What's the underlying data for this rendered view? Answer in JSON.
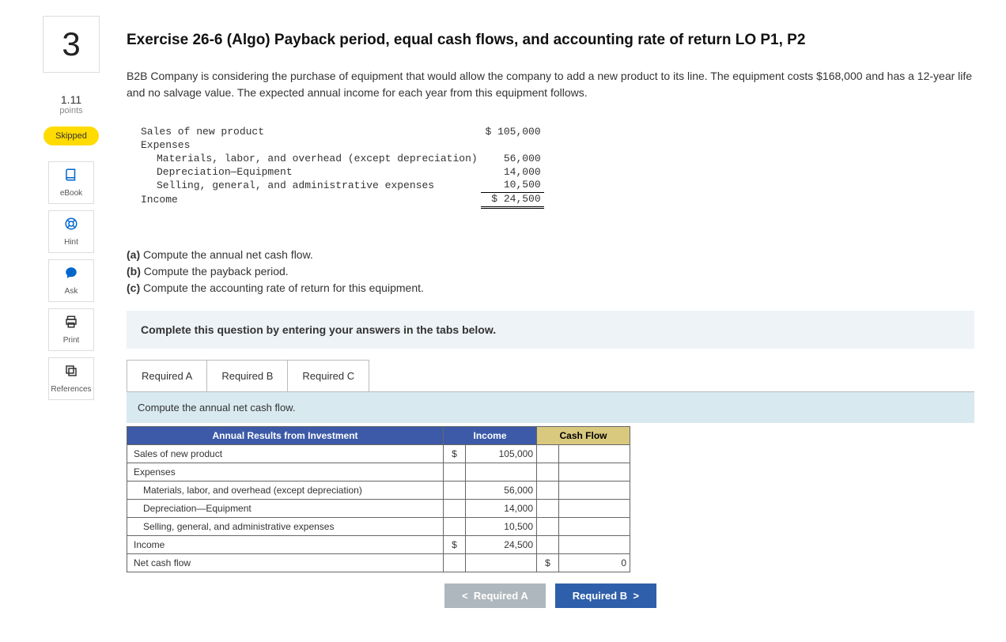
{
  "question_number": "3",
  "points_value": "1.11",
  "points_label": "points",
  "skipped_label": "Skipped",
  "tools": {
    "ebook": "eBook",
    "hint": "Hint",
    "ask": "Ask",
    "print": "Print",
    "references": "References"
  },
  "title": "Exercise 26-6 (Algo) Payback period, equal cash flows, and accounting rate of return LO P1, P2",
  "prompt": "B2B Company is considering the purchase of equipment that would allow the company to add a new product to its line. The equipment costs $168,000 and has a 12-year life and no salvage value. The expected annual income for each year from this equipment follows.",
  "income": {
    "sales_label": "Sales of new product",
    "sales_amt": "$ 105,000",
    "expenses_label": "Expenses",
    "mlo_label": "Materials, labor, and overhead (except depreciation)",
    "mlo_amt": "56,000",
    "dep_label": "Depreciation—Equipment",
    "dep_amt": "14,000",
    "sga_label": "Selling, general, and administrative expenses",
    "sga_amt": "10,500",
    "income_label": "Income",
    "income_amt": "$ 24,500"
  },
  "parts": {
    "a": "(a)",
    "a_text": " Compute the annual net cash flow.",
    "b": "(b)",
    "b_text": " Compute the payback period.",
    "c": "(c)",
    "c_text": " Compute the accounting rate of return for this equipment."
  },
  "instruction": "Complete this question by entering your answers in the tabs below.",
  "tabs": {
    "a": "Required A",
    "b": "Required B",
    "c": "Required C"
  },
  "tab_a_desc": "Compute the annual net cash flow.",
  "table": {
    "h1": "Annual Results from Investment",
    "h2": "Income",
    "h3": "Cash Flow",
    "r1": "Sales of new product",
    "r1_cur": "$",
    "r1_val": "105,000",
    "r2": "Expenses",
    "r3": "Materials, labor, and overhead (except depreciation)",
    "r3_val": "56,000",
    "r4": "Depreciation—Equipment",
    "r4_val": "14,000",
    "r5": "Selling, general, and administrative expenses",
    "r5_val": "10,500",
    "r6": "Income",
    "r6_cur": "$",
    "r6_val": "24,500",
    "r7": "Net cash flow",
    "r7_cur_cf": "$",
    "r7_val_cf": "0"
  },
  "nav": {
    "prev": "Required A",
    "next": "Required B"
  }
}
